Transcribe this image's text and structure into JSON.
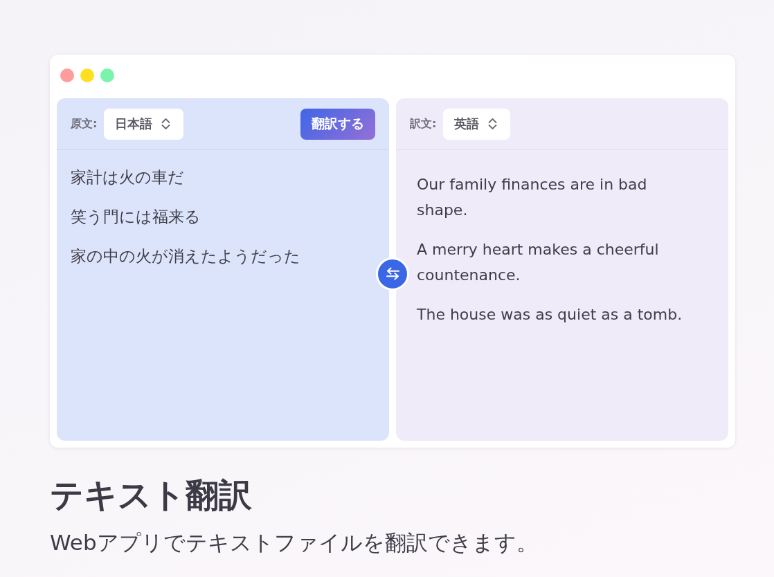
{
  "window_controls": [
    {
      "color": "#ff9d9d"
    },
    {
      "color": "#ffdf22"
    },
    {
      "color": "#7af4aa"
    }
  ],
  "panels": [
    {
      "kind": "source",
      "label": "原文:",
      "language": "日本語",
      "action": "翻訳する",
      "lines": [
        "家計は火の車だ",
        "笑う門には福来る",
        "家の中の火が消えたようだった"
      ]
    },
    {
      "kind": "target",
      "label": "訳文:",
      "language": "英語",
      "lines": [
        "Our family finances are in bad shape.",
        "A merry heart makes a cheerful countenance.",
        "The house was as quiet as a tomb."
      ]
    }
  ],
  "heading": "テキスト翻訳",
  "description": "Webアプリでテキストファイルを翻訳できます。"
}
